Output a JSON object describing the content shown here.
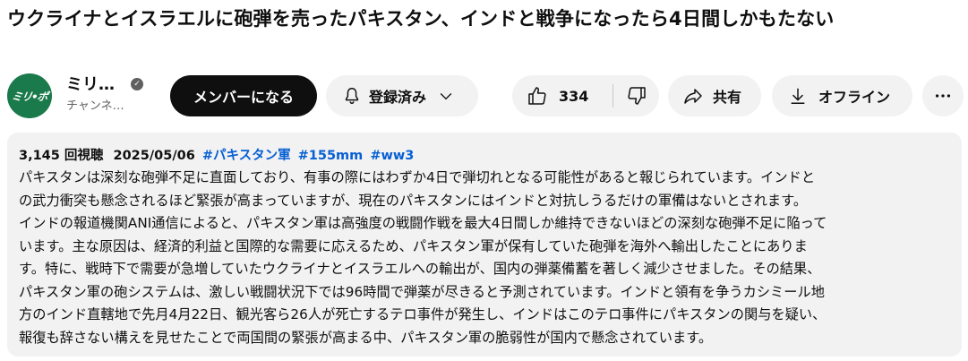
{
  "video": {
    "title": "ウクライナとイスラエルに砲弾を売ったパキスタン、インドと戦争になったら4日間しかもたない"
  },
  "channel": {
    "avatar_text": "ミリ•ポ",
    "name": "ミリ…",
    "subs": "チャンネ…"
  },
  "actions": {
    "member_label": "メンバーになる",
    "subscribe_label": "登録済み",
    "like_count": "334",
    "share_label": "共有",
    "offline_label": "オフライン"
  },
  "description": {
    "views": "3,145 回視聴",
    "date": "2025/05/06",
    "tags": [
      "#パキスタン軍",
      "#155mm",
      "#ww3"
    ],
    "lines": [
      "パキスタンは深刻な砲弾不足に直面しており、有事の際にはわずか4日で弾切れとなる可能性があると報じられています。インドと",
      "の武力衝突も懸念されるほど緊張が高まっていますが、現在のパキスタンにはインドと対抗しうるだけの軍備はないとされます。",
      "インドの報道機関ANI通信によると、パキスタン軍は高強度の戦闘作戦を最大4日間しか維持できないほどの深刻な砲弾不足に陥って",
      "います。主な原因は、経済的利益と国際的な需要に応えるため、パキスタン軍が保有していた砲弾を海外へ輸出したことにありま",
      "す。特に、戦時下で需要が急増していたウクライナとイスラエルへの輸出が、国内の弾薬備蓄を著しく減少させました。その結果、",
      "パキスタン軍の砲システムは、激しい戦闘状況下では96時間で弾薬が尽きると予測されています。インドと領有を争うカシミール地",
      "方のインド直轄地で先月4月22日、観光客ら26人が死亡するテロ事件が発生し、インドはこのテロ事件にパキスタンの関与を疑い、",
      "報復も辞さない構えを見せたことで両国間の緊張が高まる中、パキスタン軍の脆弱性が国内で懸念されています。"
    ]
  },
  "icons": {
    "verified": "verified-check-icon",
    "bell": "bell-icon",
    "chevron": "chevron-down-icon",
    "like": "thumbs-up-icon",
    "dislike": "thumbs-down-icon",
    "share": "share-arrow-icon",
    "download": "download-icon",
    "more": "more-horizontal-icon"
  },
  "colors": {
    "accent_link": "#065fd4",
    "avatar_bg": "#1a7a4b",
    "button_bg": "#f2f2f2",
    "member_bg": "#0f0f0f"
  }
}
